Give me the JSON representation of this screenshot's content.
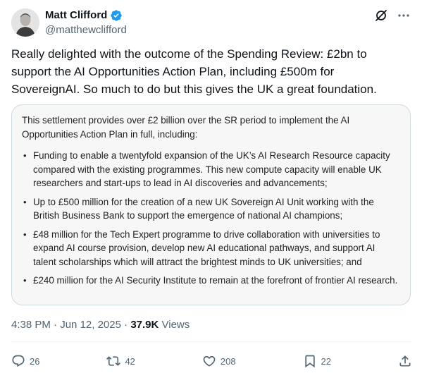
{
  "author": {
    "display_name": "Matt Clifford",
    "handle": "@matthewclifford"
  },
  "tweet": {
    "text": "Really delighted with the outcome of the Spending Review: £2bn to support the AI Opportunities Action Plan, including £500m for SovereignAI. So much to do but this gives the UK a great foundation."
  },
  "card": {
    "intro": "This settlement provides over £2 billion over the SR period to implement the AI Opportunities Action Plan in full, including:",
    "bullets": [
      "Funding to enable a twentyfold expansion of the UK’s AI Research Resource capacity compared with the existing programmes. This new compute capacity will enable UK researchers and start-ups to lead in AI discoveries and advancements;",
      "Up to £500 million for the creation of a new UK Sovereign AI Unit working with the British Business Bank to support the emergence of national AI champions;",
      "£48 million for the Tech Expert programme to drive collaboration with universities to expand AI course provision, develop new AI educational pathways, and support AI talent scholarships which will attract the brightest minds to UK universities; and",
      "£240 million for the AI Security Institute to remain at the forefront of frontier AI research."
    ]
  },
  "meta": {
    "time": "4:38 PM",
    "sep1": " · ",
    "date": "Jun 12, 2025",
    "sep2": " · ",
    "views_count": "37.9K",
    "views_label": " Views"
  },
  "actions": {
    "replies": "26",
    "reposts": "42",
    "likes": "208",
    "bookmarks": "22"
  },
  "colors": {
    "accent": "#1d9bf0",
    "muted": "#536471",
    "text": "#0f1419",
    "border": "#cfd9de"
  },
  "icons": {
    "verified": "verified-badge-icon",
    "grok": "grok-icon",
    "more": "more-icon",
    "reply": "reply-icon",
    "repost": "repost-icon",
    "like": "like-icon",
    "bookmark": "bookmark-icon",
    "share": "share-icon"
  }
}
